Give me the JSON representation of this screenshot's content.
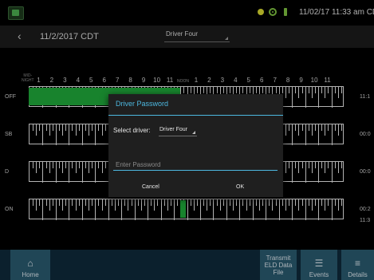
{
  "status_bar": {
    "app_icon": "eld-app-icon",
    "icons": [
      "location-icon",
      "gps-icon",
      "power-plug-icon"
    ],
    "datetime": "11/02/17 11:33 am CDT"
  },
  "header": {
    "back_icon": "chevron-left-icon",
    "date": "11/2/2017 CDT",
    "driver_select": "Driver Four"
  },
  "log_grid": {
    "midnight_label_line1": "MID-",
    "midnight_label_line2": "NIGHT",
    "hours": [
      "1",
      "2",
      "3",
      "4",
      "5",
      "6",
      "7",
      "8",
      "9",
      "10",
      "11",
      "NOON",
      "1",
      "2",
      "3",
      "4",
      "5",
      "6",
      "7",
      "8",
      "9",
      "10",
      "11"
    ],
    "rows": [
      {
        "label": "OFF",
        "total": "11:1"
      },
      {
        "label": "SB",
        "total": "00:0"
      },
      {
        "label": "D",
        "total": "00:0"
      },
      {
        "label": "ON",
        "total": "00:2"
      }
    ],
    "grand_total": "11:3",
    "duty_status_color": "#1fa83a",
    "segments": [
      {
        "row": "OFF",
        "start_hour": 0,
        "end_hour": 11.55
      },
      {
        "row": "ON",
        "start_hour": 11.55,
        "end_hour": 11.95
      }
    ]
  },
  "bottom_nav": {
    "home": {
      "label": "Home",
      "icon": "home-icon"
    },
    "transmit": {
      "line1": "Transmit",
      "line2": "ELD Data",
      "line3": "File"
    },
    "events": {
      "label": "Events",
      "icon": "list-icon"
    },
    "details": {
      "label": "Details",
      "icon": "document-icon"
    }
  },
  "dialog": {
    "title": "Driver Password",
    "select_label": "Select driver:",
    "selected_driver": "Driver Four",
    "password_placeholder": "Enter Password",
    "password_value": "",
    "cancel": "Cancel",
    "ok": "OK",
    "accent": "#4db8e0"
  }
}
